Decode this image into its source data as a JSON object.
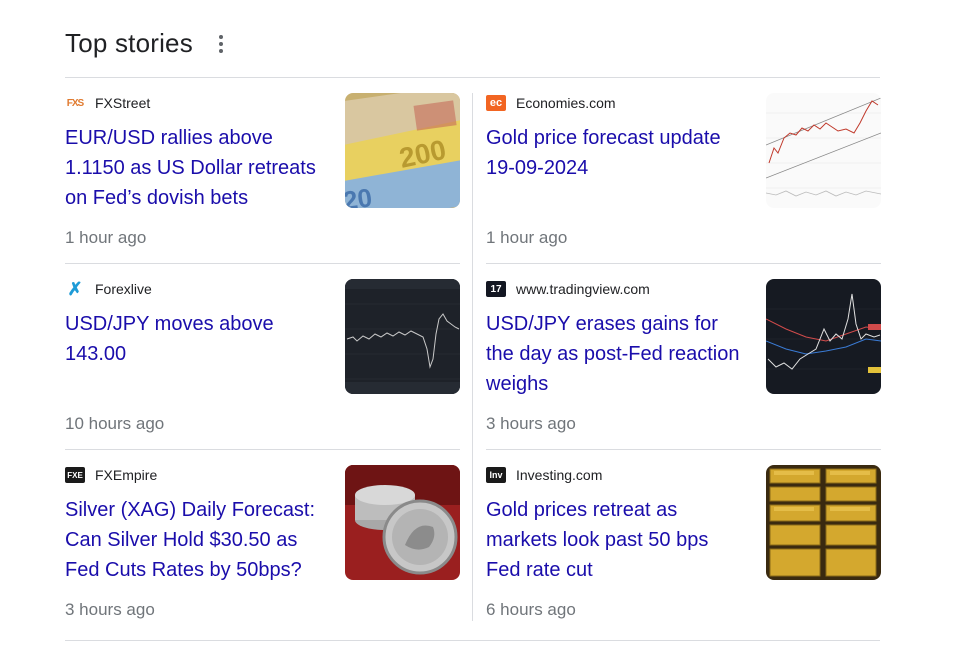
{
  "header": {
    "title": "Top stories"
  },
  "stories": [
    {
      "source": "FXStreet",
      "headline": "EUR/USD rallies above 1.1150 as US Dollar retreats on Fed’s dovish bets",
      "time": "1 hour ago",
      "favicon": "FXS"
    },
    {
      "source": "Economies.com",
      "headline": "Gold price forecast update 19-09-2024",
      "time": "1 hour ago",
      "favicon": "ec"
    },
    {
      "source": "Forexlive",
      "headline": "USD/JPY moves above 143.00",
      "time": "10 hours ago",
      "favicon": "✗"
    },
    {
      "source": "www.tradingview.com",
      "headline": "USD/JPY erases gains for the day as post-Fed reaction weighs",
      "time": "3 hours ago",
      "favicon": "17"
    },
    {
      "source": "FXEmpire",
      "headline": "Silver (XAG) Daily Forecast: Can Silver Hold $30.50 as Fed Cuts Rates by 50bps?",
      "time": "3 hours ago",
      "favicon": "FXE"
    },
    {
      "source": "Investing.com",
      "headline": "Gold prices retreat as markets look past 50 bps Fed rate cut",
      "time": "6 hours ago",
      "favicon": "Inv"
    }
  ],
  "colors": {
    "link": "#1a0dab",
    "meta": "#70757a",
    "divider": "#dadce0",
    "economies": "#f26522",
    "forexlive": "#1e9bd7",
    "dark_favicon": "#131722"
  }
}
